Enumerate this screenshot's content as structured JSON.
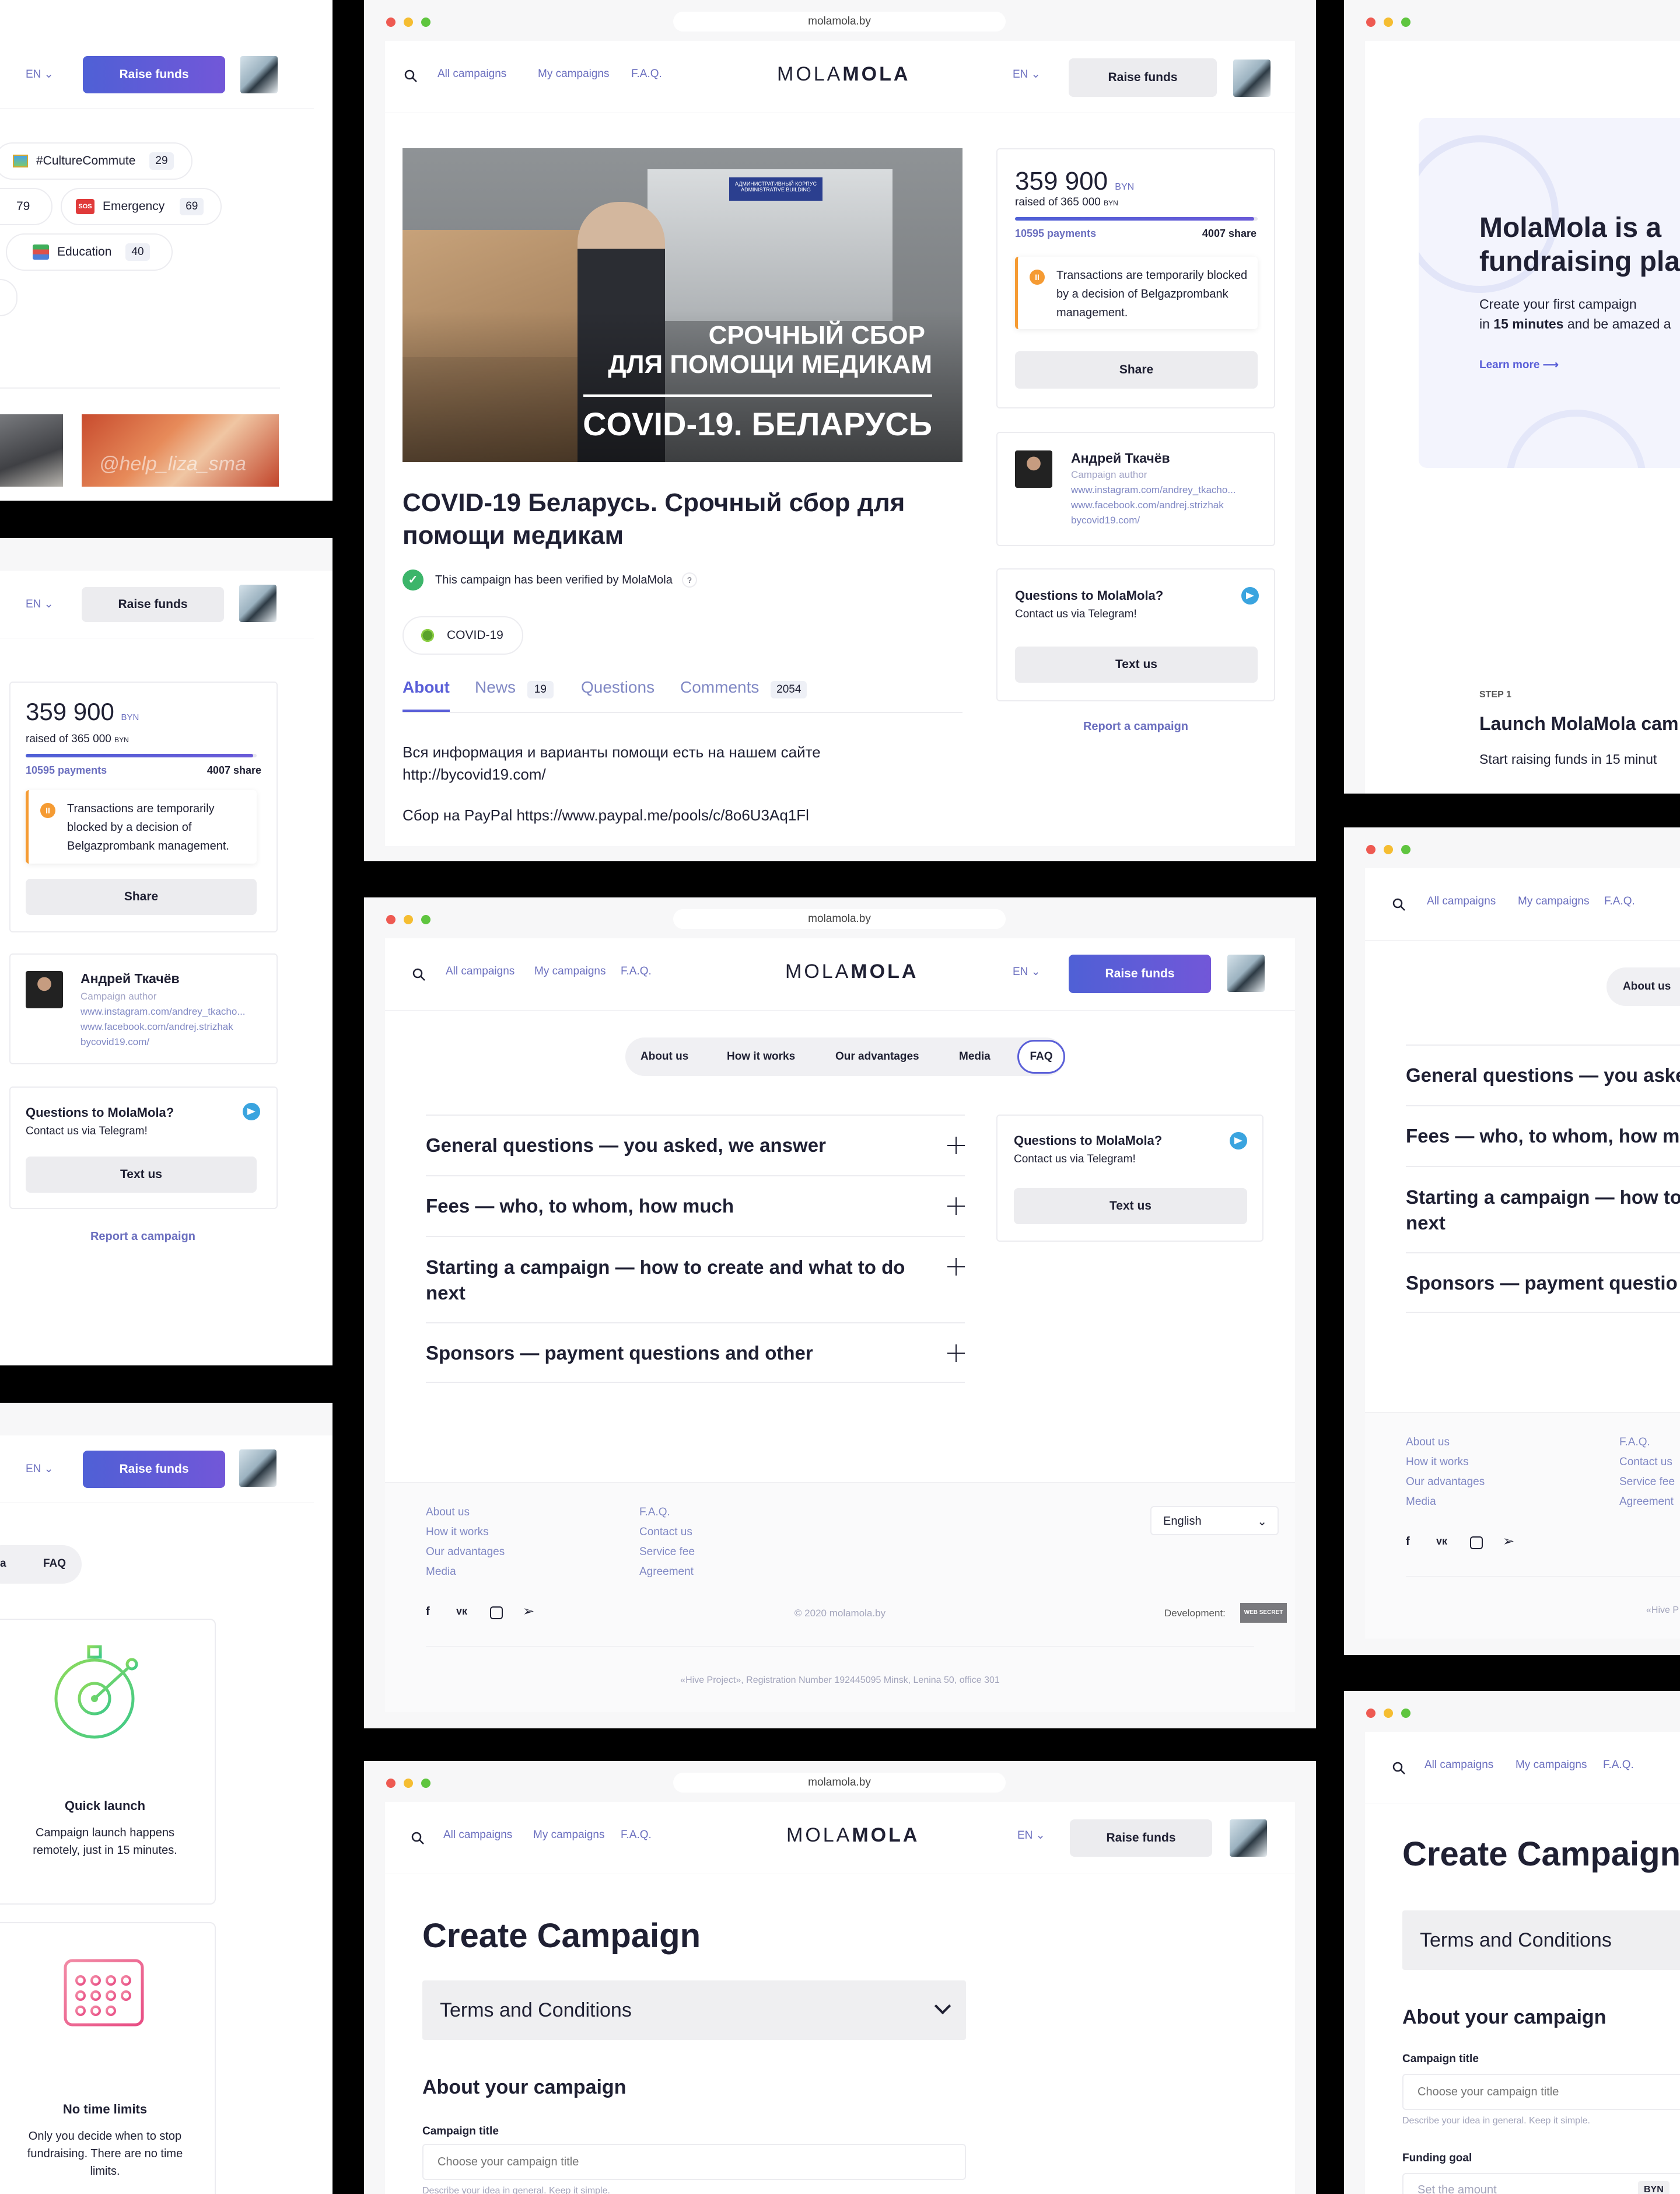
{
  "browser": {
    "url": "molamola.by"
  },
  "nav": {
    "all_campaigns": "All campaigns",
    "my_campaigns": "My campaigns",
    "faq": "F.A.Q.",
    "logo_light": "MOLA",
    "logo_bold": "MOLA",
    "lang": "EN",
    "raise_funds": "Raise funds"
  },
  "colors": {
    "accent": "#5a5fd8",
    "link": "#6b6fbf",
    "warning": "#f59b33",
    "telegram": "#3aa4df",
    "verified": "#3cb56a"
  },
  "categories": [
    {
      "label": "#CultureCommute",
      "count": "29"
    },
    {
      "label": "79",
      "count": ""
    },
    {
      "label": "Emergency",
      "count": "69"
    },
    {
      "label": "Education",
      "count": "40"
    }
  ],
  "categories_extra": {
    "sos": "SOS"
  },
  "photo_caption": "@help_liza_sma",
  "campaign": {
    "banner_line1": "СРОЧНЫЙ СБОР",
    "banner_line2": "ДЛЯ ПОМОЩИ МЕДИКАМ",
    "banner_line3": "COVID-19. БЕЛАРУСЬ",
    "sign_text": "АДМИНИСТРАТИВНЫЙ КОРПУС",
    "sign_text2": "ADMINISTRATIVE BUILDING",
    "title": "COVID-19 Беларусь. Срочный сбор для помощи медикам",
    "verified": "This campaign has been verified by MolaMola",
    "verified_help": "?",
    "tag": "COVID-19",
    "tabs": [
      {
        "label": "About",
        "count": ""
      },
      {
        "label": "News",
        "count": "19"
      },
      {
        "label": "Questions",
        "count": ""
      },
      {
        "label": "Comments",
        "count": "2054"
      }
    ],
    "body1": "Вся информация и варианты помощи есть на нашем сайте http://bycovid19.com/",
    "body2": "Сбор на PayPal https://www.paypal.me/pools/c/8o6U3Aq1Fl"
  },
  "funding": {
    "amount": "359 900",
    "currency": "BYN",
    "raised_of": "raised of 365 000",
    "payments": "10595 payments",
    "share_pct": "4007 share",
    "progress": 0.986,
    "warning": "Transactions are temporarily blocked by a decision of Belgazprombank management.",
    "warning_icon": "II",
    "share": "Share"
  },
  "author": {
    "name": "Андрей Ткачёв",
    "role": "Campaign author",
    "links": [
      "www.instagram.com/andrey_tkacho...",
      "www.facebook.com/andrej.strizhak",
      "bycovid19.com/"
    ]
  },
  "contact": {
    "title": "Questions to MolaMola?",
    "subtitle": "Contact us via Telegram!",
    "button": "Text us"
  },
  "report": "Report a campaign",
  "hero": {
    "title": "MolaMola is a fundraising pla",
    "line1": "Create your first campaign",
    "line2a": "in ",
    "line2b": "15 minutes",
    "line2c": " and be amazed a",
    "learn": "Learn more",
    "step": "STEP 1",
    "step_title": "Launch MolaMola cam",
    "step_desc": "Start raising funds in 15 minut"
  },
  "faq_tabs": [
    "About us",
    "How it works",
    "Our advantages",
    "Media",
    "FAQ"
  ],
  "faq": [
    "General questions — you asked, we answer",
    "Fees — who, to whom, how much",
    "Starting a campaign — how to create and what to do next",
    "Sponsors — payment questions and other"
  ],
  "faq_cut": [
    "General questions — you aske",
    "Fees — who, to whom, how mu",
    "Starting a campaign — how to",
    "next",
    "Sponsors — payment questio"
  ],
  "footer": {
    "col1": [
      "About us",
      "How it works",
      "Our advantages",
      "Media"
    ],
    "col2": [
      "F.A.Q.",
      "Contact us",
      "Service fee",
      "Agreement"
    ],
    "language": "English",
    "copyright": "© 2020 molamola.by",
    "development": "Development:",
    "dev_logo": "WEB SECRET",
    "registration": "«Hive Project», Registration Number 192445095 Minsk, Lenina 50, office 301",
    "registration_cut": "«Hive P"
  },
  "advantages": [
    {
      "title": "Quick launch",
      "text": "Campaign launch happens remotely, just in 15 minutes."
    },
    {
      "title": "No time limits",
      "text": "Only you decide when to stop fundraising. There are no time limits."
    }
  ],
  "advantages_tab_cut": "a",
  "create": {
    "title": "Create Campaign",
    "title_cut": "Create Campaign",
    "terms": "Terms and Conditions",
    "about": "About your campaign",
    "field_title": "Campaign title",
    "field_placeholder": "Choose your campaign title",
    "field_hint": "Describe your idea in general. Keep it simple.",
    "goal_label": "Funding goal",
    "goal_placeholder": "Set the amount",
    "goal_currency": "BYN"
  }
}
